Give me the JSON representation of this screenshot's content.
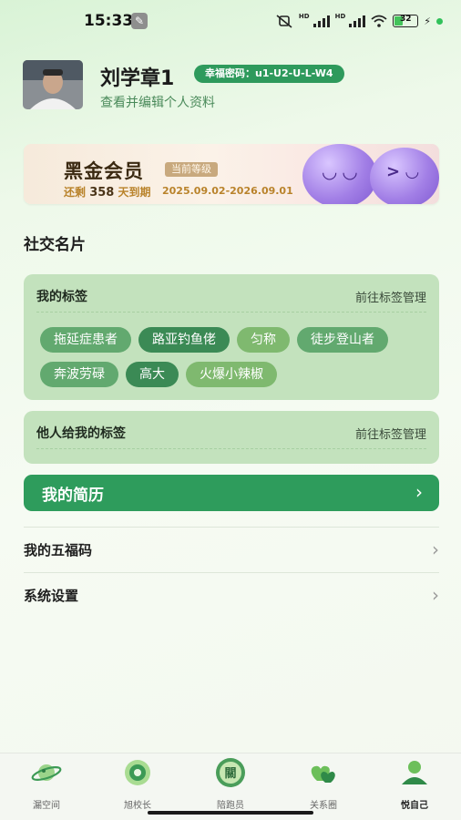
{
  "status_bar": {
    "time": "15:33",
    "battery": "32",
    "battery_level": 0.32
  },
  "profile": {
    "name": "刘学章1",
    "lucky_code": "幸福密码：u1-U2-U-L-W4",
    "edit_link": "查看并编辑个人资料"
  },
  "vip": {
    "title": "黑金会员",
    "level_badge": "当前等级",
    "remaining_prefix": "还剩",
    "remaining_days": "358",
    "remaining_suffix": "天到期",
    "date_range": "2025.09.02-2026.09.01"
  },
  "social": {
    "section_title": "社交名片",
    "my_tags": {
      "title": "我的标签",
      "link": "前往标签管理",
      "tags": [
        "拖延症患者",
        "路亚钓鱼佬",
        "匀称",
        "徒步登山者",
        "奔波劳碌",
        "高大",
        "火爆小辣椒"
      ]
    },
    "others_tags": {
      "title": "他人给我的标签",
      "link": "前往标签管理"
    }
  },
  "resume": {
    "label": "我的简历"
  },
  "menu": {
    "items": [
      "我的五福码",
      "系统设置"
    ]
  },
  "tab_bar": {
    "tabs": [
      "漏空间",
      "旭校长",
      "陪跑员",
      "关系圈",
      "悦自己"
    ],
    "active": "悦自己"
  },
  "colors": {
    "accent": "#2e9c5c",
    "tag_dark": "#3b8a55",
    "tag_mid": "#62a96f",
    "tag_light": "#7fb96f",
    "card_bg": "#c3e2bd"
  }
}
